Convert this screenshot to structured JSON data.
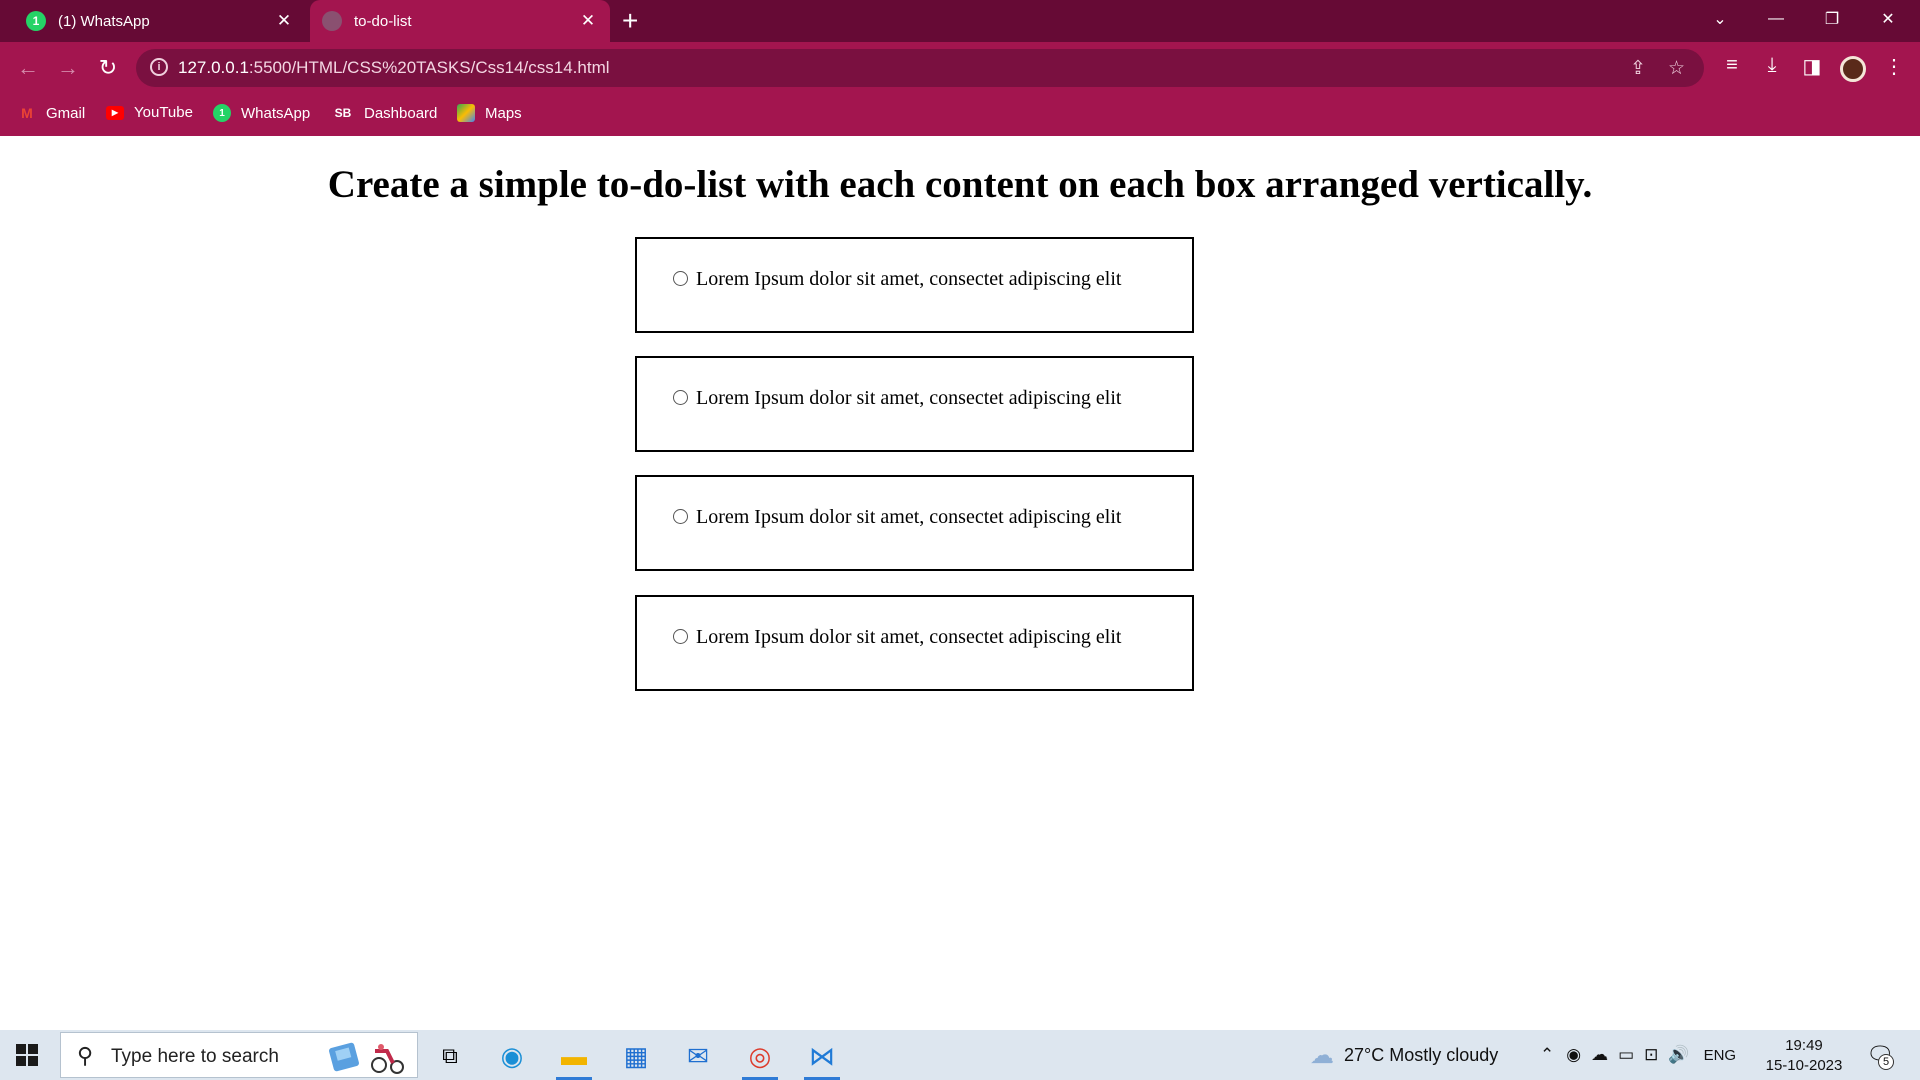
{
  "browser": {
    "tabs": [
      {
        "title": "(1) WhatsApp",
        "favicon": "whatsapp-icon",
        "badge": "1"
      },
      {
        "title": "to-do-list",
        "favicon": "globe-icon"
      }
    ],
    "url_host": "127.0.0.1",
    "url_path": ":5500/HTML/CSS%20TASKS/Css14/css14.html",
    "bookmarks": [
      {
        "label": "Gmail",
        "icon": "gmail-icon"
      },
      {
        "label": "YouTube",
        "icon": "youtube-icon"
      },
      {
        "label": "WhatsApp",
        "icon": "whatsapp-icon",
        "badge": "1"
      },
      {
        "label": "Dashboard",
        "icon": "sb-icon",
        "icon_text": "SB"
      },
      {
        "label": "Maps",
        "icon": "maps-icon"
      }
    ],
    "colors": {
      "tabbar": "#660a35",
      "toolbar": "#a3154f",
      "omnibox": "#7a1040"
    }
  },
  "page": {
    "heading": "Create a simple to-do-list with each content on each box arranged vertically.",
    "items": [
      {
        "label": "Lorem Ipsum dolor sit amet, consectet adipiscing elit"
      },
      {
        "label": "Lorem Ipsum dolor sit amet, consectet adipiscing elit"
      },
      {
        "label": "Lorem Ipsum dolor sit amet, consectet adipiscing elit"
      },
      {
        "label": "Lorem Ipsum dolor sit amet, consectet adipiscing elit"
      }
    ]
  },
  "taskbar": {
    "search_placeholder": "Type here to search",
    "weather": "27°C  Mostly cloudy",
    "language": "ENG",
    "time": "19:49",
    "date": "15-10-2023",
    "notification_count": "5"
  }
}
